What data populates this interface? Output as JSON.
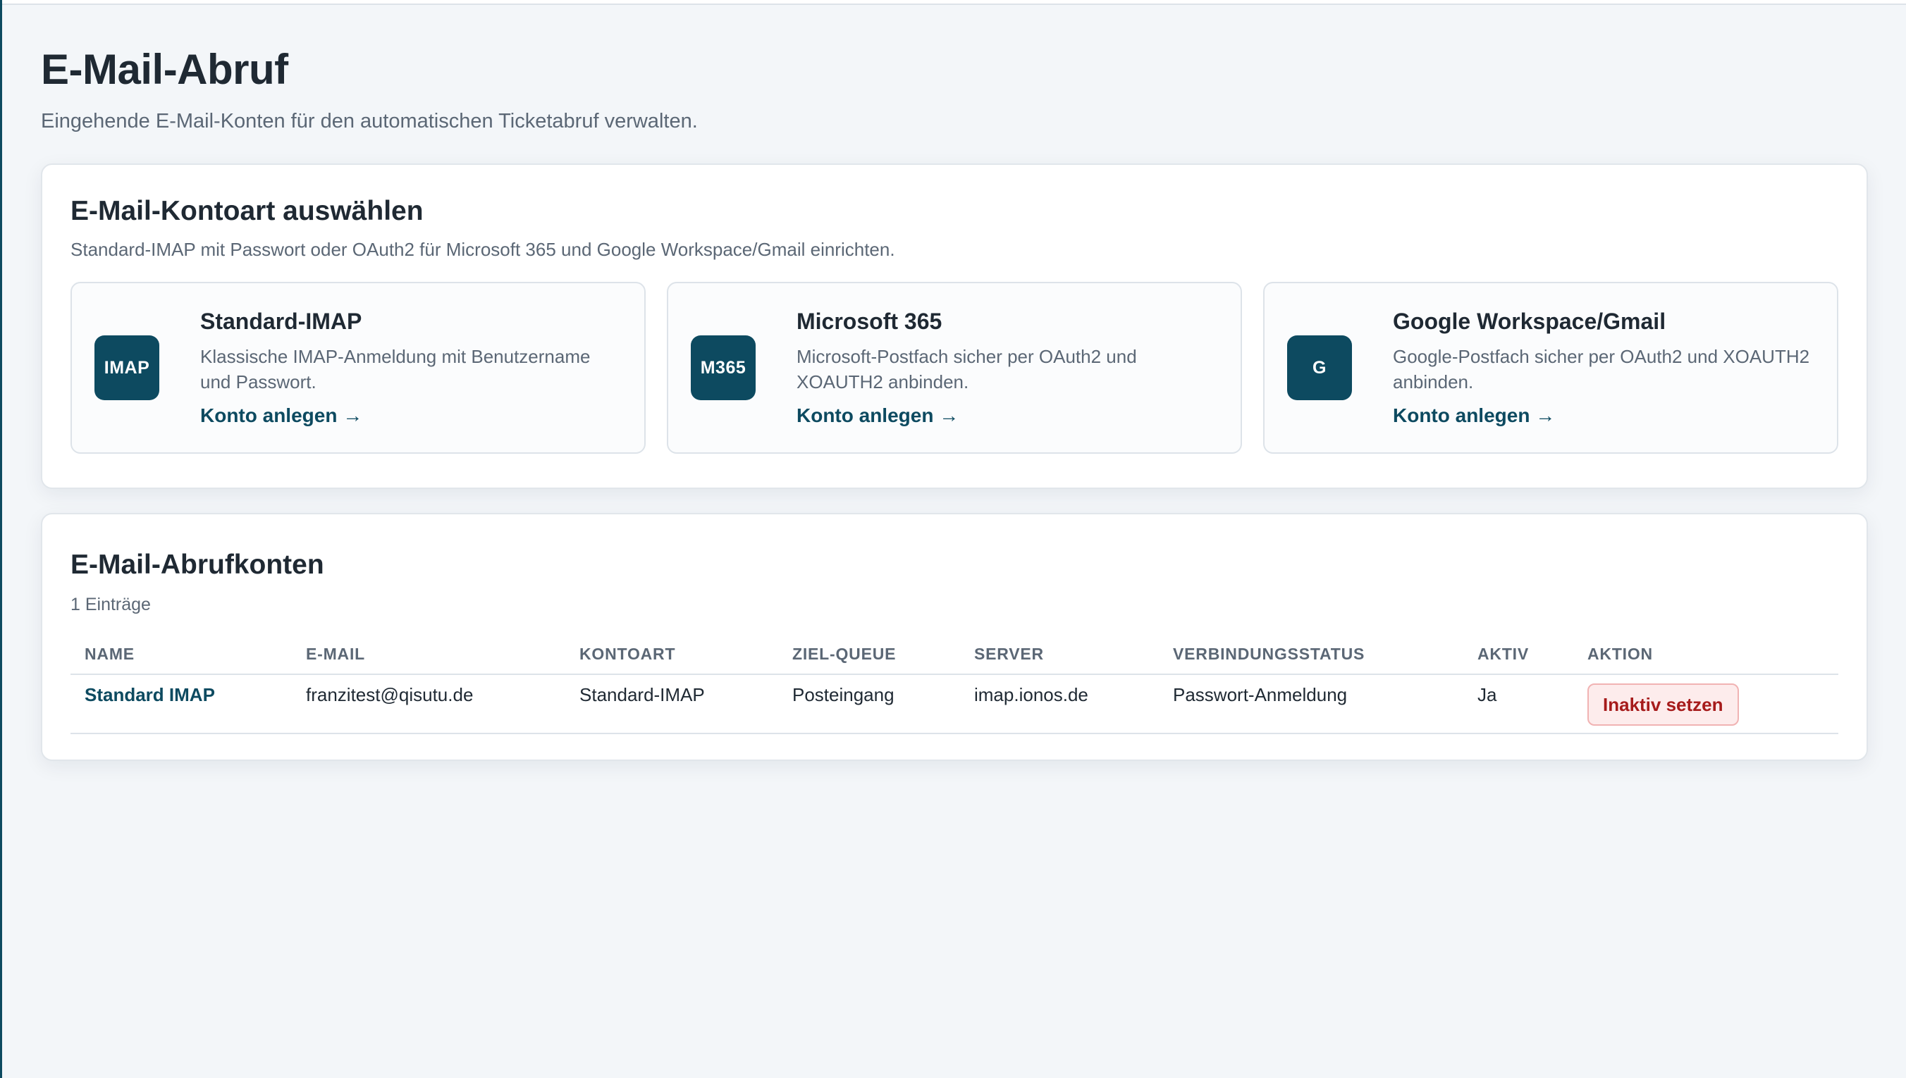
{
  "page": {
    "title": "E-Mail-Abruf",
    "subtitle": "Eingehende E-Mail-Konten für den automatischen Ticketabruf verwalten."
  },
  "account_types": {
    "title": "E-Mail-Kontoart auswählen",
    "description": "Standard-IMAP mit Passwort oder OAuth2 für Microsoft 365 und Google Workspace/Gmail einrichten.",
    "items": [
      {
        "badge": "IMAP",
        "name": "Standard-IMAP",
        "text": "Klassische IMAP-Anmeldung mit Benutzername und Passwort.",
        "link": "Konto anlegen →"
      },
      {
        "badge": "M365",
        "name": "Microsoft 365",
        "text": "Microsoft-Postfach sicher per OAuth2 und XOAUTH2 anbinden.",
        "link": "Konto anlegen →"
      },
      {
        "badge": "G",
        "name": "Google Workspace/Gmail",
        "text": "Google-Postfach sicher per OAuth2 und XOAUTH2 anbinden.",
        "link": "Konto anlegen →"
      }
    ]
  },
  "accounts": {
    "title": "E-Mail-Abrufkonten",
    "count_label": "1 Einträge",
    "columns": [
      "NAME",
      "E-MAIL",
      "KONTOART",
      "ZIEL-QUEUE",
      "SERVER",
      "VERBINDUNGSSTATUS",
      "AKTIV",
      "AKTION"
    ],
    "rows": [
      {
        "name": "Standard IMAP",
        "email": "franzitest@qisutu.de",
        "type": "Standard-IMAP",
        "queue": "Posteingang",
        "server": "imap.ionos.de",
        "status": "Passwort-Anmeldung",
        "active": "Ja",
        "action": "Inaktiv setzen"
      }
    ]
  },
  "colors": {
    "accent": "#0d4a60",
    "danger_text": "#a61b1b",
    "danger_bg": "#fdecec",
    "background": "#f3f6f9"
  }
}
